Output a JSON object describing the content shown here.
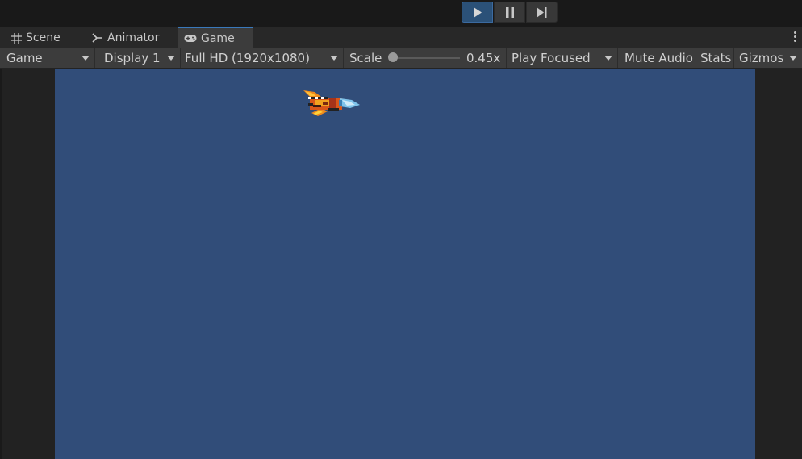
{
  "playbar": {
    "play_icon": "play-icon",
    "pause_icon": "pause-icon",
    "step_icon": "step-icon"
  },
  "tabs": [
    {
      "label": "Scene",
      "icon": "grid-icon"
    },
    {
      "label": "Animator",
      "icon": "animator-icon"
    },
    {
      "label": "Game",
      "icon": "gamepad-icon"
    }
  ],
  "toolbar": {
    "view_select": "Game",
    "display_select": "Display 1",
    "resolution_select": "Full HD (1920x1080)",
    "scale_label": "Scale",
    "scale_value_text": "0.45x",
    "scale_value": 0.45,
    "play_mode_select": "Play Focused",
    "mute_audio": "Mute Audio",
    "stats": "Stats",
    "gizmos": "Gizmos"
  },
  "colors": {
    "game_background": "#314d79",
    "active_play": "#2b5178",
    "tab_accent": "#3a79bb"
  }
}
